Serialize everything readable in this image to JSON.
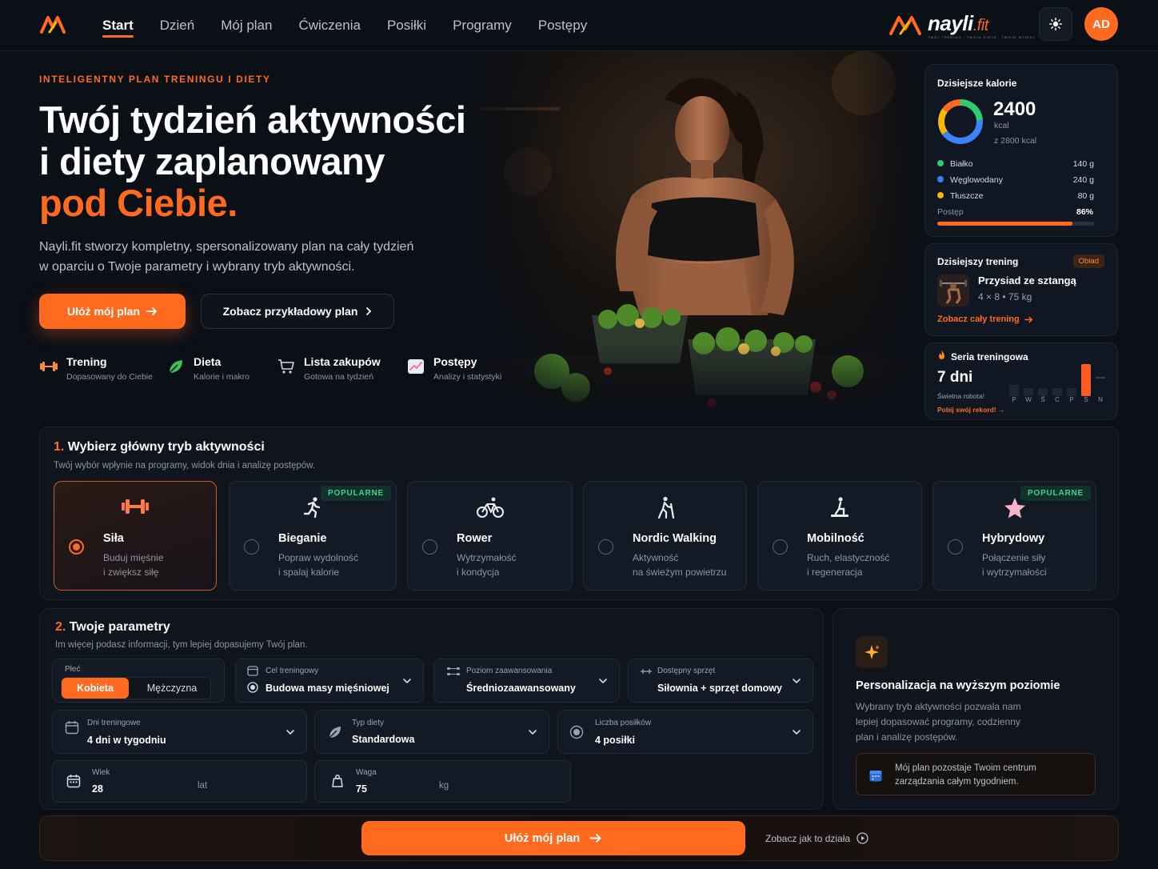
{
  "nav": {
    "items": [
      "Start",
      "Dzień",
      "Mój plan",
      "Ćwiczenia",
      "Posiłki",
      "Programy",
      "Postępy"
    ],
    "brand_name": "nayli",
    "brand_suffix": ".fit",
    "brand_tagline": "TWÓJ TRENING · TWOJA DIETA · TWOJE WYNIKI",
    "avatar_initials": "AD",
    "theme_icon": "sun-icon"
  },
  "hero": {
    "eyebrow": "INTELIGENTNY PLAN TRENINGU I DIETY",
    "title_line1": "Twój tydzień aktywności",
    "title_line2": "i diety zaplanowany",
    "title_line3": "pod Ciebie.",
    "lead_line1": "Nayli.fit stworzy kompletny, spersonalizowany plan na cały tydzień",
    "lead_line2": "w oparciu o Twoje parametry i wybrany tryb aktywności.",
    "primary_cta": "Ułóż mój plan",
    "secondary_cta": "Zobacz przykładowy plan",
    "features": [
      {
        "icon": "dumbbell-icon",
        "title": "Trening",
        "sub": "Dopasowany do Ciebie"
      },
      {
        "icon": "leaf-icon",
        "title": "Dieta",
        "sub": "Kalorie i makro"
      },
      {
        "icon": "cart-icon",
        "title": "Lista zakupów",
        "sub": "Gotowa na tydzień"
      },
      {
        "icon": "chart-icon",
        "title": "Postępy",
        "sub": "Analizy i statystyki"
      }
    ]
  },
  "calories": {
    "title": "Dzisiejsze kalorie",
    "value": "2400",
    "unit": "kcal",
    "of": "z 2800 kcal",
    "macros": [
      {
        "name": "Białko",
        "value": "140 g",
        "color": "#2ecc71"
      },
      {
        "name": "Węglowodany",
        "value": "240 g",
        "color": "#3b82f6"
      },
      {
        "name": "Tłuszcze",
        "value": "80 g",
        "color": "#f5b70a"
      }
    ],
    "progress_label": "Postęp",
    "progress_value": "86%",
    "progress_fraction": 0.86
  },
  "workout": {
    "title": "Dzisiejszy trening",
    "badge": "Obiad",
    "exercise": "Przysiad ze sztangą",
    "detail": "4 × 8 • 75 kg",
    "link": "Zobacz cały trening"
  },
  "streak": {
    "title": "Seria treningowa",
    "value": "7 dni",
    "sub": "Świetna robota!",
    "link": "Pobij swój rekord!",
    "days": [
      "P",
      "W",
      "Ś",
      "C",
      "P",
      "S",
      "N"
    ],
    "levels": [
      0.35,
      0.25,
      0.25,
      0.25,
      0.25,
      1.0,
      0.1
    ]
  },
  "step1": {
    "num": "1.",
    "title": "Wybierz główny tryb aktywności",
    "sub": "Twój wybór wpłynie na programy, widok dnia i analizę postępów.",
    "modes": [
      {
        "icon": "dumbbell-icon",
        "title": "Siła",
        "d1": "Buduj mięśnie",
        "d2": "i zwiększ siłę",
        "badge": "",
        "selected": true
      },
      {
        "icon": "runner-icon",
        "title": "Bieganie",
        "d1": "Popraw wydolność",
        "d2": "i spalaj kalorie",
        "badge": "POPULARNE",
        "selected": false
      },
      {
        "icon": "bike-icon",
        "title": "Rower",
        "d1": "Wytrzymałość",
        "d2": "i kondycja",
        "badge": "",
        "selected": false
      },
      {
        "icon": "walker-icon",
        "title": "Nordic Walking",
        "d1": "Aktywność",
        "d2": "na świeżym powietrzu",
        "badge": "",
        "selected": false
      },
      {
        "icon": "yoga-icon",
        "title": "Mobilność",
        "d1": "Ruch, elastyczność",
        "d2": "i regeneracja",
        "badge": "",
        "selected": false
      },
      {
        "icon": "star-icon",
        "title": "Hybrydowy",
        "d1": "Połączenie siły",
        "d2": "i wytrzymałości",
        "badge": "POPULARNE",
        "selected": false
      }
    ]
  },
  "step2": {
    "num": "2.",
    "title": "Twoje parametry",
    "sub": "Im więcej podasz informacji, tym lepiej dopasujemy Twój plan.",
    "gender_label": "Płeć",
    "gender_female": "Kobieta",
    "gender_male": "Mężczyzna",
    "goal_label": "Cel treningowy",
    "goal_value": "Budowa masy mięśniowej",
    "level_label": "Poziom zaawansowania",
    "level_value": "Średniozaawansowany",
    "equip_label": "Dostępny sprzęt",
    "equip_value": "Siłownia + sprzęt domowy",
    "days_label": "Dni treningowe",
    "days_value": "4 dni w tygodniu",
    "diet_label": "Typ diety",
    "diet_value": "Standardowa",
    "meals_label": "Liczba posiłków",
    "meals_value": "4 posiłki",
    "age_label": "Wiek",
    "age_value": "28",
    "age_unit": "lat",
    "weight_label": "Waga",
    "weight_value": "75",
    "weight_unit": "kg"
  },
  "personal": {
    "title": "Personalizacja na wyższym poziomie",
    "p1": "Wybrany tryb aktywności pozwala nam",
    "p2": "lepiej dopasować programy, codzienny",
    "p3": "plan i analizę postępów.",
    "note1": "Mój plan pozostaje Twoim centrum",
    "note2": "zarządzania całym tygodniem."
  },
  "bottom": {
    "cta": "Ułóż mój plan",
    "how": "Zobacz jak to działa"
  },
  "colors": {
    "accent": "#ff6a1f",
    "bg": "#0b0f16",
    "card": "#111722"
  }
}
